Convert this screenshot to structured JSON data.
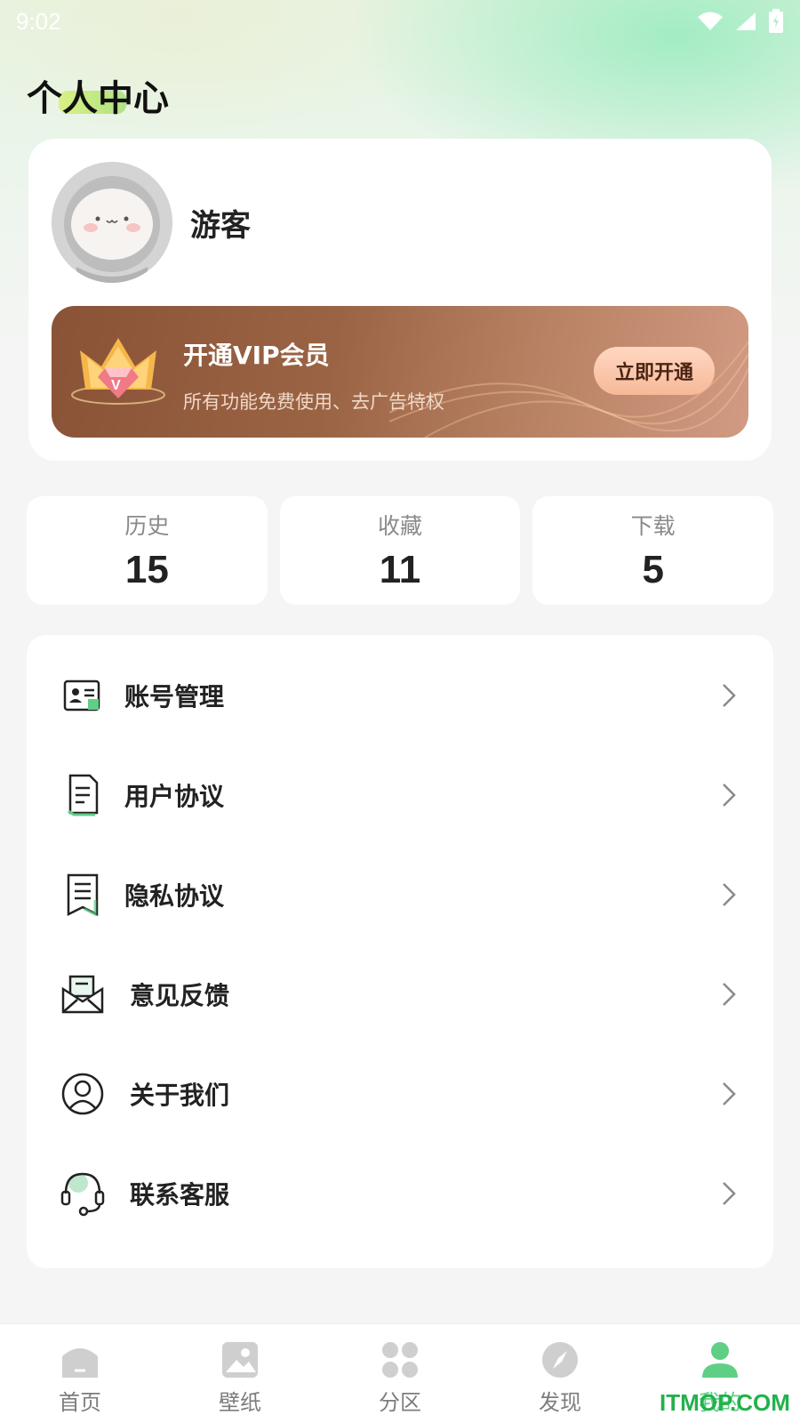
{
  "status_bar": {
    "time": "9:02"
  },
  "page": {
    "title": "个人中心"
  },
  "profile": {
    "username": "游客"
  },
  "vip": {
    "title": "开通VIP会员",
    "subtitle": "所有功能免费使用、去广告特权",
    "button_label": "立即开通"
  },
  "stats": [
    {
      "label": "历史",
      "value": "15"
    },
    {
      "label": "收藏",
      "value": "11"
    },
    {
      "label": "下载",
      "value": "5"
    }
  ],
  "menu": [
    {
      "label": "账号管理",
      "icon": "id-card-icon"
    },
    {
      "label": "用户协议",
      "icon": "document-icon"
    },
    {
      "label": "隐私协议",
      "icon": "bookmark-document-icon"
    },
    {
      "label": "意见反馈",
      "icon": "mail-icon"
    },
    {
      "label": "关于我们",
      "icon": "user-circle-icon"
    },
    {
      "label": "联系客服",
      "icon": "headset-icon"
    }
  ],
  "tabs": [
    {
      "label": "首页",
      "icon": "home-icon",
      "active": false
    },
    {
      "label": "壁纸",
      "icon": "image-icon",
      "active": false
    },
    {
      "label": "分区",
      "icon": "grid-icon",
      "active": false
    },
    {
      "label": "发现",
      "icon": "compass-icon",
      "active": false
    },
    {
      "label": "我的",
      "icon": "person-icon",
      "active": true
    }
  ],
  "watermark": "ITMOP.COM",
  "colors": {
    "accent_green": "#5fcf86",
    "vip_brown": "#8a5236",
    "vip_button": "#f7b998"
  }
}
